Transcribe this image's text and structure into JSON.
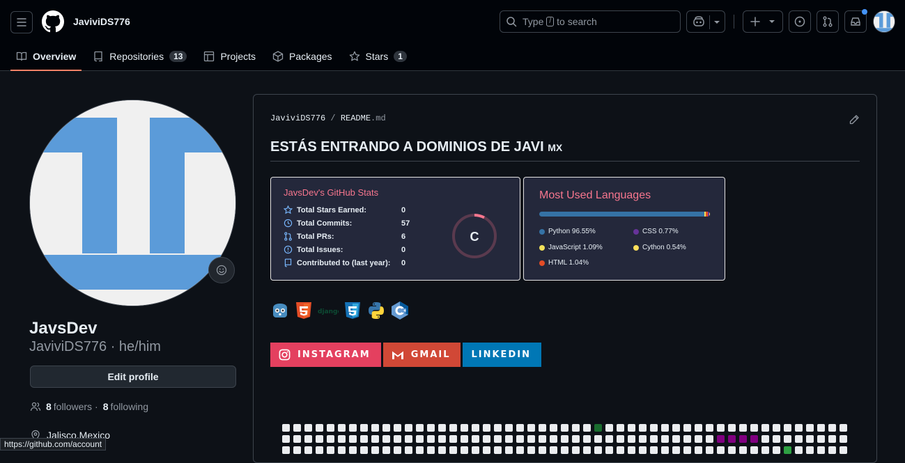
{
  "header": {
    "username": "JaviviDS776",
    "search_prefix": "Type",
    "search_key": "/",
    "search_suffix": "to search"
  },
  "tabs": [
    {
      "label": "Overview",
      "active": true
    },
    {
      "label": "Repositories",
      "count": "13"
    },
    {
      "label": "Projects"
    },
    {
      "label": "Packages"
    },
    {
      "label": "Stars",
      "count": "1"
    }
  ],
  "profile": {
    "display_name": "JavsDev",
    "login_line": "JaviviDS776 · he/him",
    "edit_label": "Edit profile",
    "followers_count": "8",
    "followers_label": "followers",
    "sep": "·",
    "following_count": "8",
    "following_label": "following",
    "location": "Jalisco,Mexico"
  },
  "status_url": "https://github.com/account",
  "readme": {
    "owner": "JaviviDS776",
    "sep": "/",
    "file_base": "README",
    "file_ext": ".md",
    "heading": "ESTÁS ENTRANDO A DOMINIOS DE JAVI",
    "heading_flag": "MX"
  },
  "stats_card": {
    "title": "JavsDev's GitHub Stats",
    "rows": [
      {
        "label": "Total Stars Earned:",
        "value": "0",
        "icon": "star-icon"
      },
      {
        "label": "Total Commits:",
        "value": "57",
        "icon": "history-icon"
      },
      {
        "label": "Total PRs:",
        "value": "6",
        "icon": "pull-request-icon"
      },
      {
        "label": "Total Issues:",
        "value": "0",
        "icon": "issue-icon"
      },
      {
        "label": "Contributed to (last year):",
        "value": "0",
        "icon": "repo-icon"
      }
    ],
    "grade": "C"
  },
  "lang_card": {
    "title": "Most Used Languages",
    "languages": [
      {
        "label": "Python 96.55%",
        "color": "#3572a5",
        "pct": 96.55
      },
      {
        "label": "CSS 0.77%",
        "color": "#663399",
        "pct": 0.77
      },
      {
        "label": "JavaScript 1.09%",
        "color": "#f1e05a",
        "pct": 1.09
      },
      {
        "label": "Cython 0.54%",
        "color": "#fedf5b",
        "pct": 0.54
      },
      {
        "label": "HTML 1.04%",
        "color": "#e34c26",
        "pct": 1.04
      }
    ]
  },
  "tech": [
    "godot-icon",
    "html5-icon",
    "django-icon",
    "css3-icon",
    "python-icon",
    "c-icon"
  ],
  "tech_django_text": "django",
  "socials": [
    {
      "label": "INSTAGRAM",
      "color": "#e4405f",
      "icon": "instagram-icon"
    },
    {
      "label": "GMAIL",
      "color": "#d14836",
      "icon": "gmail-icon"
    },
    {
      "label": "LINKEDIN",
      "color": "#0077b5",
      "icon": "linkedin-icon"
    }
  ]
}
